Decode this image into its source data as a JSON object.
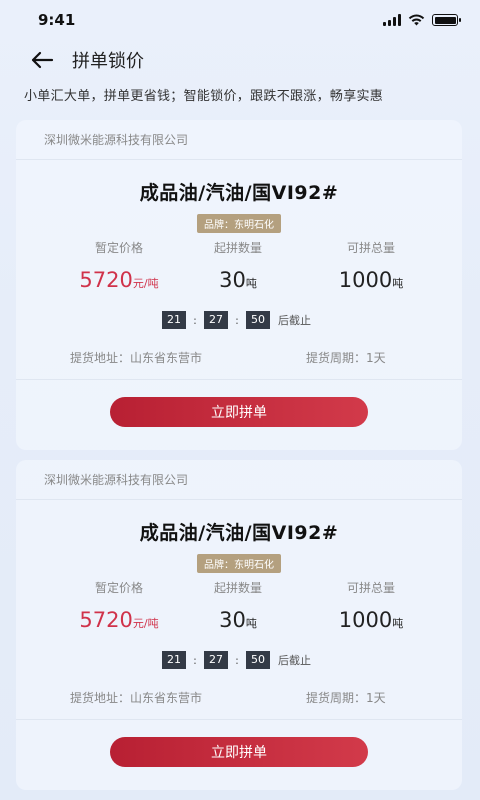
{
  "status": {
    "time": "9:41"
  },
  "nav": {
    "title": "拼单锁价"
  },
  "subtitle": "小单汇大单，拼单更省钱；智能锁价，跟跌不跟涨，畅享实惠",
  "cards": [
    {
      "company": "深圳微米能源科技有限公司",
      "product": "成品油/汽油/国VI92#",
      "brand": "品牌：东明石化",
      "price_label": "暂定价格",
      "price": "5720",
      "price_unit": "元/吨",
      "min_label": "起拼数量",
      "min_qty": "30",
      "min_unit": "吨",
      "total_label": "可拼总量",
      "total_qty": "1000",
      "total_unit": "吨",
      "timer": {
        "h": "21",
        "m": "27",
        "s": "50",
        "sep": ":",
        "suffix": "后截止"
      },
      "address": "提货地址：山东省东营市",
      "period": "提货周期：1天",
      "button": "立即拼单"
    },
    {
      "company": "深圳微米能源科技有限公司",
      "product": "成品油/汽油/国VI92#",
      "brand": "品牌：东明石化",
      "price_label": "暂定价格",
      "price": "5720",
      "price_unit": "元/吨",
      "min_label": "起拼数量",
      "min_qty": "30",
      "min_unit": "吨",
      "total_label": "可拼总量",
      "total_qty": "1000",
      "total_unit": "吨",
      "timer": {
        "h": "21",
        "m": "27",
        "s": "50",
        "sep": ":",
        "suffix": "后截止"
      },
      "address": "提货地址：山东省东营市",
      "period": "提货周期：1天",
      "button": "立即拼单"
    }
  ],
  "colors": {
    "accent": "#d0324a",
    "button": "#c22a3d",
    "brand_badge": "#b4a07f",
    "timer_box": "#333a46"
  },
  "icons": {
    "back": "arrow-left-icon",
    "signal": "signal-icon",
    "wifi": "wifi-icon",
    "battery": "battery-icon"
  }
}
